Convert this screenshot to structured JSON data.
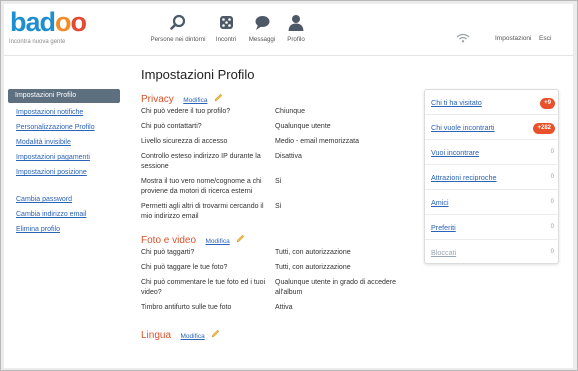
{
  "brand": {
    "logo_b": "b",
    "logo_a": "a",
    "logo_d": "d",
    "logo_o1": "o",
    "logo_o2": "o",
    "tagline": "Incontra nuova gente",
    "colors": {
      "blue": "#1d8ecf",
      "orange": "#f28c28",
      "red": "#e34a2f"
    }
  },
  "nav": {
    "people": {
      "label": "Persone nei dintorni",
      "icon": "search-icon"
    },
    "encounters": {
      "label": "Incontri",
      "icon": "dice-icon"
    },
    "messages": {
      "label": "Messaggi",
      "icon": "chat-bubble-icon"
    },
    "profile": {
      "label": "Profilo",
      "icon": "user-icon"
    }
  },
  "topright": {
    "settings": "Impostazioni",
    "logout": "Esci",
    "signal_icon": "wifi-icon"
  },
  "sidebar": {
    "active": "Impostazioni Profilo",
    "group1": [
      "Impostazioni notifiche",
      "Personalizzazione Profilo",
      "Modalità invisibile",
      "Impostazioni pagamenti",
      "Impostazioni posizione"
    ],
    "group2": [
      "Cambia password",
      "Cambia indirizzo email",
      "Elimina profilo"
    ]
  },
  "main": {
    "title": "Impostazioni Profilo",
    "edit_label": "Modifica",
    "privacy": {
      "name": "Privacy",
      "rows": [
        {
          "q": "Chi può vedere il tuo profilo?",
          "a": "Chiunque"
        },
        {
          "q": "Chi può contattarti?",
          "a": "Qualunque utente"
        },
        {
          "q": "Livello sicurezza di accesso",
          "a": "Medio - email memorizzata"
        },
        {
          "q": "Controllo esteso indirizzo IP durante la sessione",
          "a": "Disattiva"
        },
        {
          "q": "Mostra il tuo vero nome/cognome a chi proviene da motori di ricerca esterni",
          "a": "Sì"
        },
        {
          "q": "Permetti agli altri di trovarmi cercando il mio indirizzo email",
          "a": "Sì"
        }
      ]
    },
    "photo": {
      "name": "Foto e video",
      "rows": [
        {
          "q": "Chi può taggarti?",
          "a": "Tutti, con autorizzazione"
        },
        {
          "q": "Chi può taggare le tue foto?",
          "a": "Tutti, con autorizzazione"
        },
        {
          "q": "Chi può commentare le tue foto ed i tuoi video?",
          "a": "Qualunque utente in grado di accedere all'album"
        },
        {
          "q": "Timbro antifurto sulle tue foto",
          "a": "Attiva"
        }
      ]
    },
    "language": {
      "name": "Lingua"
    }
  },
  "panel": {
    "items": [
      {
        "label": "Chi ti ha visitato",
        "count": "+9",
        "badge": true
      },
      {
        "label": "Chi vuole incontrarti",
        "count": "+282",
        "badge": true
      },
      {
        "label": "Vuoi incontrare",
        "count": "0",
        "badge": false
      },
      {
        "label": "Attrazioni reciproche",
        "count": "0",
        "badge": false
      },
      {
        "label": "Amici",
        "count": "0",
        "badge": false
      },
      {
        "label": "Preferiti",
        "count": "0",
        "badge": false
      },
      {
        "label": "Bloccati",
        "count": "0",
        "badge": false
      }
    ],
    "badge_color": "#e8512c"
  }
}
